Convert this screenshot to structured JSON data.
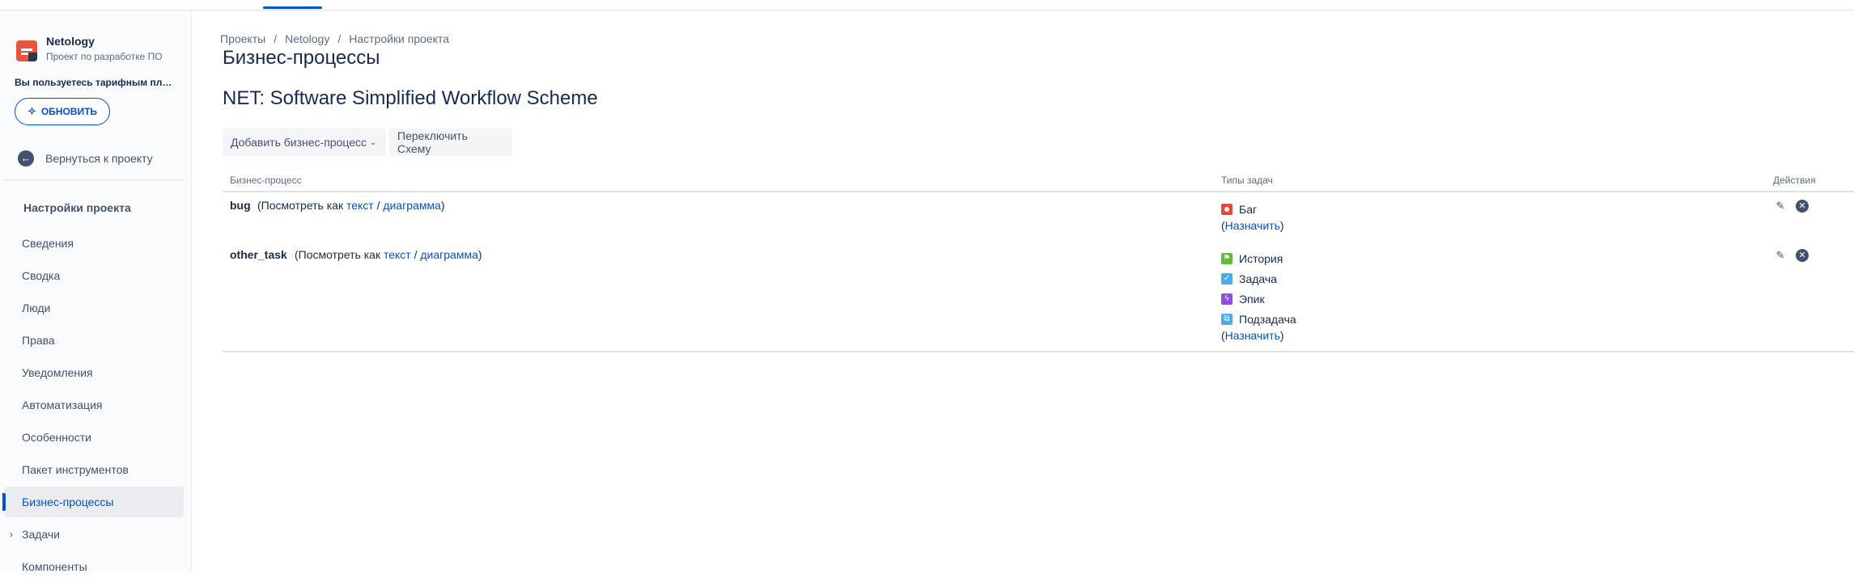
{
  "sidebar": {
    "project_name": "Netology",
    "project_type": "Проект по разработке ПО",
    "plan_text": "Вы пользуетесь тарифным планом Free",
    "upgrade_label": "ОБНОВИТЬ",
    "back_label": "Вернуться к проекту",
    "settings_header": "Настройки проекта",
    "items": [
      {
        "label": "Сведения"
      },
      {
        "label": "Сводка"
      },
      {
        "label": "Люди"
      },
      {
        "label": "Права"
      },
      {
        "label": "Уведомления"
      },
      {
        "label": "Автоматизация"
      },
      {
        "label": "Особенности"
      },
      {
        "label": "Пакет инструментов"
      },
      {
        "label": "Бизнес-процессы"
      },
      {
        "label": "Задачи"
      },
      {
        "label": "Компоненты"
      }
    ],
    "active_item": "Бизнес-процессы"
  },
  "breadcrumb": [
    "Проекты",
    "Netology",
    "Настройки проекта"
  ],
  "page_title": "Бизнес-процессы",
  "scheme_title": "NET: Software Simplified Workflow Scheme",
  "buttons": {
    "add_workflow": "Добавить бизнес-процесс",
    "switch_scheme": "Переключить Схему"
  },
  "table": {
    "headers": {
      "workflow": "Бизнес-процесс",
      "issue_types": "Типы задач",
      "actions": "Действия"
    },
    "rows": [
      {
        "name": "bug",
        "view_prefix": "(Посмотреть как ",
        "view_text": "текст",
        "view_sep": " / ",
        "view_diagram": "диаграмма",
        "view_suffix": ")",
        "types": [
          {
            "name": "Баг",
            "icon": "bug-icon"
          }
        ],
        "assign_open": "(",
        "assign_label": "Назначить",
        "assign_close": ")"
      },
      {
        "name": "other_task",
        "view_prefix": "(Посмотреть как ",
        "view_text": "текст",
        "view_sep": " / ",
        "view_diagram": "диаграмма",
        "view_suffix": ")",
        "types": [
          {
            "name": "История",
            "icon": "story-icon"
          },
          {
            "name": "Задача",
            "icon": "task-icon"
          },
          {
            "name": "Эпик",
            "icon": "epic-icon"
          },
          {
            "name": "Подзадача",
            "icon": "subtask-icon"
          }
        ],
        "assign_open": "(",
        "assign_label": "Назначить",
        "assign_close": ")"
      }
    ]
  },
  "colors": {
    "accent": "#0052cc",
    "bug": "#e5493a",
    "story": "#63ba3c",
    "task": "#4bade8",
    "epic": "#904ee2"
  }
}
